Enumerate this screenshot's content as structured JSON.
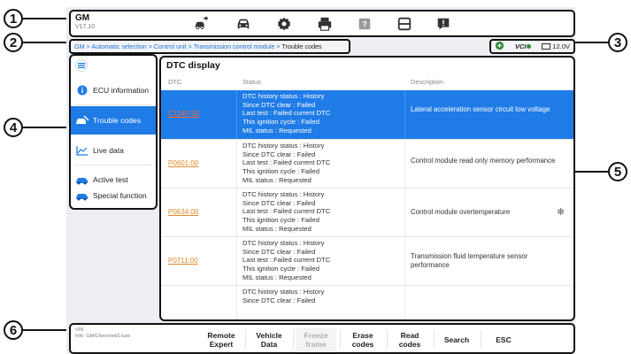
{
  "callouts": [
    "1",
    "2",
    "3",
    "4",
    "5",
    "6"
  ],
  "header": {
    "brand": "GM",
    "version": "V17.10",
    "icons": [
      "vehicle-swap-icon",
      "car-icon",
      "gear-icon",
      "print-icon",
      "help-icon",
      "save-icon",
      "feedback-icon"
    ]
  },
  "breadcrumb": {
    "path": "GM > Automatic selection > Control unit > Transmission control module > ",
    "current": "Trouble codes"
  },
  "status": {
    "vci": "VCI",
    "voltage": "12.0V"
  },
  "sidebar": {
    "items": [
      {
        "label": "ECU information",
        "icon": "info-icon",
        "active": false
      },
      {
        "label": "Trouble codes",
        "icon": "car-wrench-icon",
        "active": true
      },
      {
        "label": "Live data",
        "icon": "line-chart-icon",
        "active": false
      },
      {
        "label": "Active test",
        "icon": "car-test-icon",
        "active": false
      },
      {
        "label": "Special function",
        "icon": "car-special-icon",
        "active": false
      }
    ]
  },
  "dtc": {
    "title": "DTC display",
    "columns": {
      "dtc": "DTC",
      "status": "Status",
      "description": "Description"
    },
    "rows": [
      {
        "code": "C124F:00",
        "status": [
          "DTC history status : History",
          "Since DTC clear : Failed",
          "Last test : Failed current DTC",
          "This ignition cycle : Failed",
          "MIL status : Requested"
        ],
        "description": "Lateral acceleration sensor circuit low voltage",
        "selected": true
      },
      {
        "code": "P0601:00",
        "status": [
          "DTC history status : History",
          "Since DTC clear : Failed",
          "Last test : Failed current DTC",
          "This ignition cycle : Failed",
          "MIL status : Requested"
        ],
        "description": "Control module read only memory performance",
        "selected": false
      },
      {
        "code": "P0634:00",
        "status": [
          "DTC history status : History",
          "Since DTC clear : Failed",
          "Last test : Failed current DTC",
          "This ignition cycle : Failed",
          "MIL status : Requested"
        ],
        "description": "Control module overtemperature",
        "selected": false,
        "freeze_frame": true
      },
      {
        "code": "P0711:00",
        "status": [
          "DTC history status : History",
          "Since DTC clear : Failed",
          "Last test : Failed current DTC",
          "This ignition cycle : Failed",
          "MIL status : Requested"
        ],
        "description": "Transmission fluid temperature sensor performance",
        "selected": false
      },
      {
        "code": "",
        "status": [
          "DTC history status : History",
          "Since DTC clear : Failed"
        ],
        "description": "",
        "selected": false
      }
    ]
  },
  "bottom": {
    "vin_label": "VIN",
    "info": "Info: GM/Chevrolet/Cruze",
    "buttons": [
      {
        "label": "Remote Expert",
        "enabled": true
      },
      {
        "label": "Vehicle Data",
        "enabled": true
      },
      {
        "label": "Freeze frame",
        "enabled": false
      },
      {
        "label": "Erase codes",
        "enabled": true
      },
      {
        "label": "Read codes",
        "enabled": true
      },
      {
        "label": "Search",
        "enabled": true
      },
      {
        "label": "ESC",
        "enabled": true
      }
    ]
  },
  "colors": {
    "accent": "#1f7be6",
    "dtc_code": "#e08a2a",
    "outline": "#111111"
  }
}
